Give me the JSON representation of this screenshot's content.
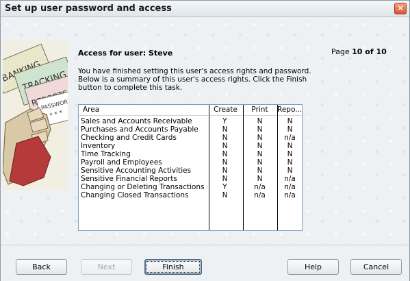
{
  "window": {
    "title": "Set up user password and access",
    "close_glyph": "✕"
  },
  "side_image": {
    "labels": [
      "BANKING",
      "TRACKING",
      "REPORTS",
      "PASSWORD",
      "* * * *"
    ]
  },
  "header": {
    "access_heading": "Access for user: Steve",
    "page_prefix": "Page ",
    "page_value": "10 of 10"
  },
  "instructions": "You have finished setting this user's access rights and password. Below is a summary of this user's access rights.  Click the Finish button to complete this task.",
  "summary": {
    "columns": [
      "Area",
      "Create",
      "Print",
      "Repo..."
    ],
    "rows": [
      {
        "area": "Sales and Accounts Receivable",
        "create": "Y",
        "print": "N",
        "report": "N"
      },
      {
        "area": "Purchases and Accounts Payable",
        "create": "N",
        "print": "N",
        "report": "N"
      },
      {
        "area": "Checking and Credit Cards",
        "create": "N",
        "print": "N",
        "report": "n/a"
      },
      {
        "area": "Inventory",
        "create": "N",
        "print": "N",
        "report": "N"
      },
      {
        "area": "Time Tracking",
        "create": "N",
        "print": "N",
        "report": "N"
      },
      {
        "area": "Payroll and Employees",
        "create": "N",
        "print": "N",
        "report": "N"
      },
      {
        "area": "Sensitive Accounting Activities",
        "create": "N",
        "print": "N",
        "report": "N"
      },
      {
        "area": "Sensitive Financial Reports",
        "create": "N",
        "print": "N",
        "report": "n/a"
      },
      {
        "area": "Changing or Deleting Transactions",
        "create": "Y",
        "print": "n/a",
        "report": "n/a"
      },
      {
        "area": "Changing Closed Transactions",
        "create": "N",
        "print": "n/a",
        "report": "n/a"
      }
    ]
  },
  "buttons": {
    "back": "Back",
    "next": "Next",
    "finish": "Finish",
    "help": "Help",
    "cancel": "Cancel"
  },
  "colors": {
    "close_red": "#d7532e",
    "panel_bg": "#eef1f3",
    "list_border": "#7f9db9"
  }
}
